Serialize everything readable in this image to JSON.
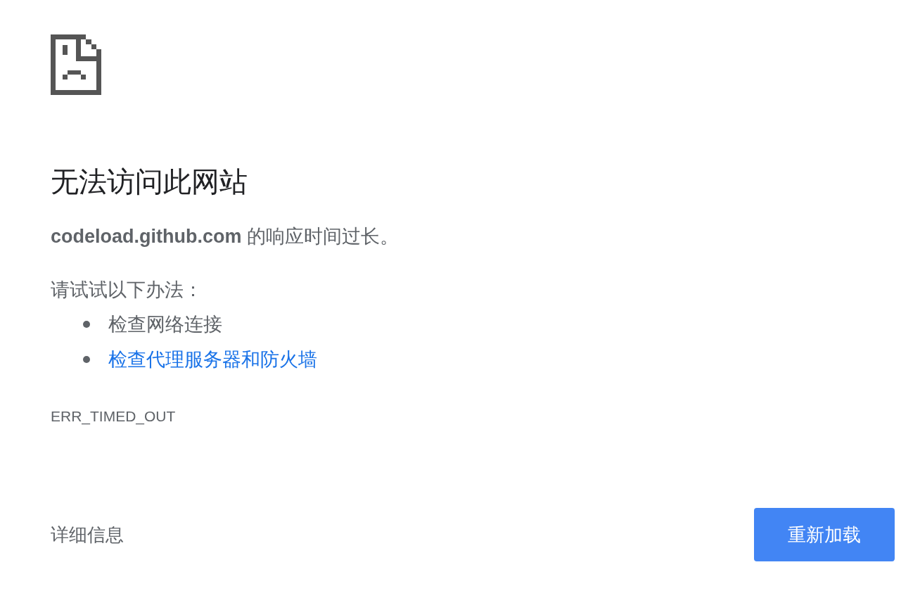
{
  "title": "无法访问此网站",
  "message": "**codeload.github.com** 的响应时间过长。",
  "suggestions_heading": "请试试以下办法：",
  "suggestions": [
    {
      "text": "检查网络连接",
      "kind": "text"
    },
    {
      "text": "检查代理服务器和防火墙",
      "kind": "link"
    }
  ],
  "error_code": "ERR_TIMED_OUT",
  "details_button": "详细信息",
  "reload_button": "重新加载"
}
